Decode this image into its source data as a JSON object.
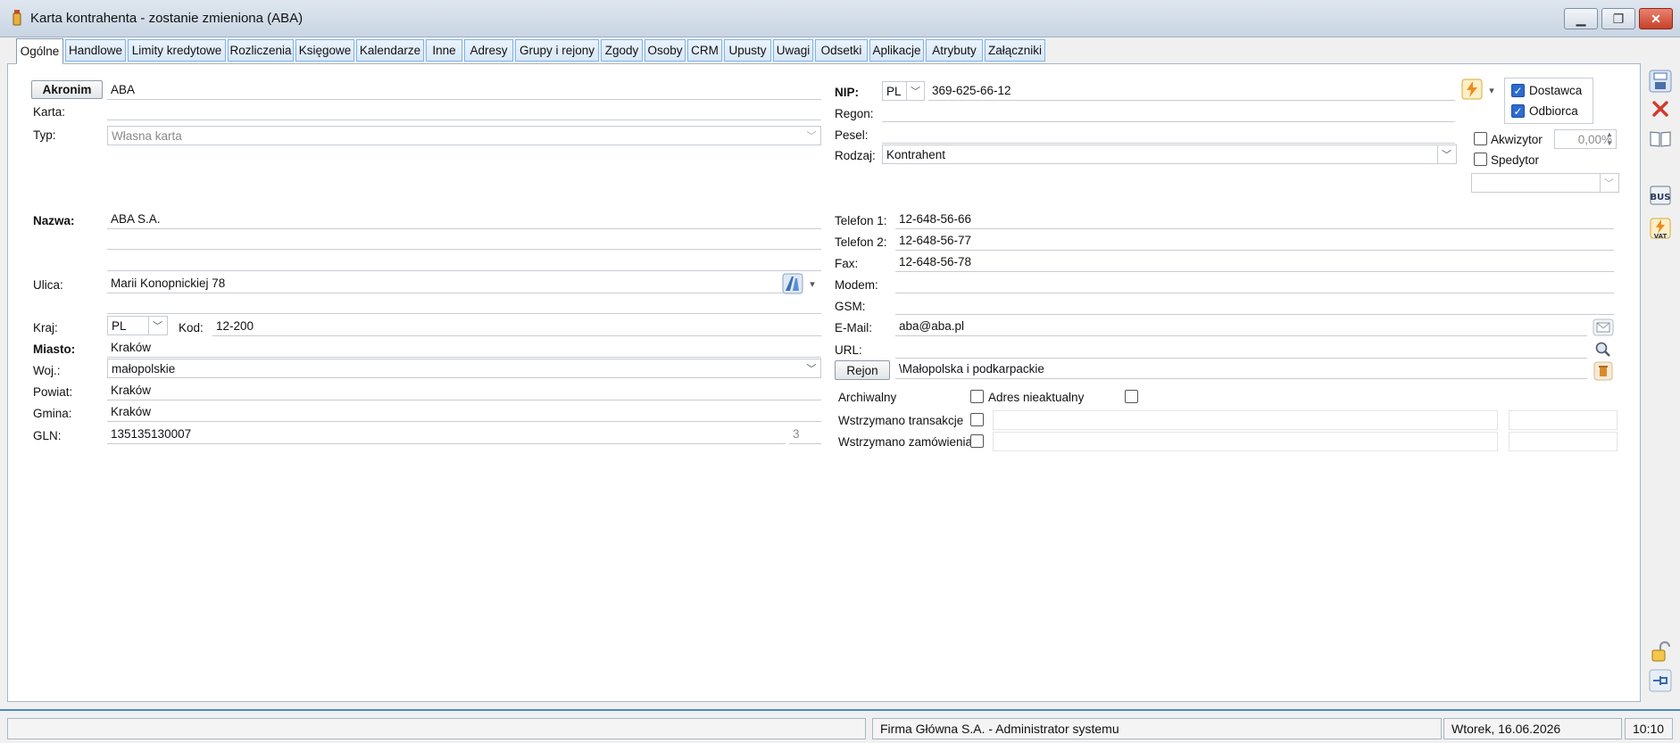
{
  "window": {
    "title": "Karta kontrahenta - zostanie zmieniona (ABA)"
  },
  "tabs": [
    "Ogólne",
    "Handlowe",
    "Limity kredytowe",
    "Rozliczenia",
    "Księgowe",
    "Kalendarze",
    "Inne",
    "Adresy",
    "Grupy i rejony",
    "Zgody",
    "Osoby",
    "CRM",
    "Upusty",
    "Uwagi",
    "Odsetki",
    "Aplikacje",
    "Atrybuty",
    "Załączniki"
  ],
  "left": {
    "akronim_label": "Akronim",
    "akronim_value": "ABA",
    "karta_label": "Karta:",
    "karta_value": "",
    "typ_label": "Typ:",
    "typ_value": "Własna karta",
    "nazwa_label": "Nazwa:",
    "nazwa_value": "ABA S.A.",
    "ulica_label": "Ulica:",
    "ulica_value": "Marii Konopnickiej 78",
    "kraj_label": "Kraj:",
    "kraj_value": "PL",
    "kod_label": "Kod:",
    "kod_value": "12-200",
    "miasto_label": "Miasto:",
    "miasto_value": "Kraków",
    "woj_label": "Woj.:",
    "woj_value": "małopolskie",
    "powiat_label": "Powiat:",
    "powiat_value": "Kraków",
    "gmina_label": "Gmina:",
    "gmina_value": "Kraków",
    "gln_label": "GLN:",
    "gln_value": "135135130007",
    "gln_check": "3"
  },
  "right": {
    "nip_label": "NIP:",
    "nip_country": "PL",
    "nip_value": "369-625-66-12",
    "regon_label": "Regon:",
    "pesel_label": "Pesel:",
    "rodzaj_label": "Rodzaj:",
    "rodzaj_value": "Kontrahent",
    "dostawca_label": "Dostawca",
    "odbiorca_label": "Odbiorca",
    "akwizytor_label": "Akwizytor",
    "akwizytor_pct": "0,00%",
    "spedytor_label": "Spedytor",
    "tel1_label": "Telefon 1:",
    "tel1_value": "12-648-56-66",
    "tel2_label": "Telefon 2:",
    "tel2_value": "12-648-56-77",
    "fax_label": "Fax:",
    "fax_value": "12-648-56-78",
    "modem_label": "Modem:",
    "gsm_label": "GSM:",
    "email_label": "E-Mail:",
    "email_value": "aba@aba.pl",
    "url_label": "URL:",
    "rejon_button": "Rejon",
    "rejon_value": "\\Małopolska i podkarpackie",
    "archiwalny_label": "Archiwalny",
    "adres_label": "Adres nieaktualny",
    "wstrz_trans_label": "Wstrzymano transakcje",
    "wstrz_zam_label": "Wstrzymano zamówienia"
  },
  "status": {
    "company": "Firma Główna S.A. - Administrator systemu",
    "date": "Wtorek, 16.06.2026",
    "time": "10:10"
  }
}
